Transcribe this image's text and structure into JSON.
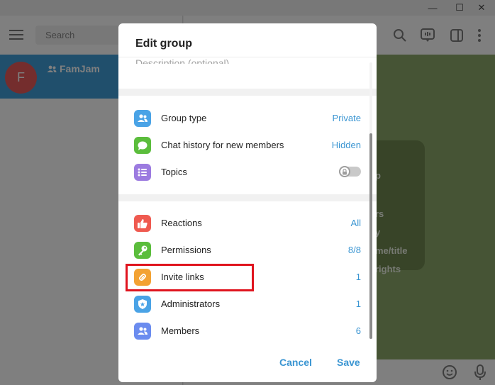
{
  "window": {
    "minimize_glyph": "—",
    "maximize_glyph": "☐",
    "close_glyph": "✕"
  },
  "sidebar": {
    "search_placeholder": "Search",
    "chats": [
      {
        "initial": "F",
        "name": "FamJam"
      }
    ]
  },
  "chat_background": {
    "info_lines": [
      "p",
      "",
      "rs",
      "y",
      "me/title",
      " rights"
    ]
  },
  "modal": {
    "title": "Edit group",
    "description_placeholder": "Description (optional)",
    "group_settings": [
      {
        "label": "Group type",
        "value": "Private",
        "icon": "group-icon",
        "color": "#4aa3e6"
      },
      {
        "label": "Chat history for new members",
        "value": "Hidden",
        "icon": "chat-bubble-icon",
        "color": "#5bbd3c"
      },
      {
        "label": "Topics",
        "value": "",
        "icon": "topics-list-icon",
        "color": "#9c7be0",
        "toggle": "off",
        "locked": true
      }
    ],
    "management": [
      {
        "label": "Reactions",
        "value": "All",
        "icon": "thumbs-up-icon",
        "color": "#ef5a50"
      },
      {
        "label": "Permissions",
        "value": "8/8",
        "icon": "key-icon",
        "color": "#5bbd3c"
      },
      {
        "label": "Invite links",
        "value": "1",
        "icon": "link-icon",
        "color": "#f3a233"
      },
      {
        "label": "Administrators",
        "value": "1",
        "icon": "shield-star-icon",
        "color": "#4aa3e6"
      },
      {
        "label": "Members",
        "value": "6",
        "icon": "group-icon",
        "color": "#6b8cef"
      }
    ],
    "cancel_label": "Cancel",
    "save_label": "Save"
  },
  "colors": {
    "accent": "#3a95d2",
    "highlight": "#e0141e",
    "chat_selected": "#419fd9"
  }
}
